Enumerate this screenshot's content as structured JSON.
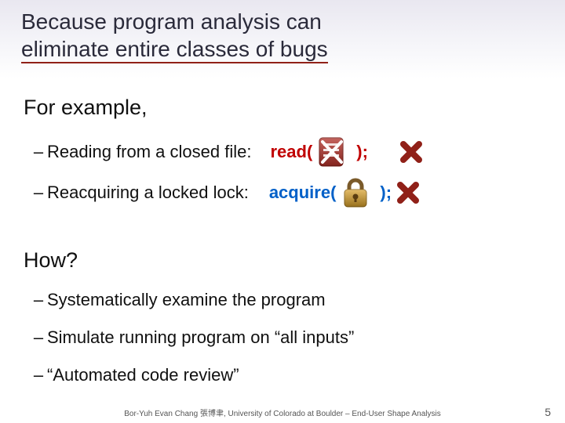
{
  "title": {
    "line1": "Because program analysis can",
    "line2": "eliminate entire classes of bugs"
  },
  "for_example_label": "For example,",
  "examples": [
    {
      "desc": "Reading from a closed file:",
      "call": "read(",
      "close": ");",
      "color": "red"
    },
    {
      "desc": "Reacquiring a locked lock:",
      "call": "acquire(",
      "close": ");",
      "color": "blue"
    }
  ],
  "how_label": "How?",
  "how_items": [
    "Systematically examine the program",
    "Simulate running program on “all inputs”",
    "“Automated code review”"
  ],
  "footer": "Bor-Yuh Evan Chang 張博聿, University of Colorado at Boulder – End-User Shape Analysis",
  "page": "5",
  "icons": {
    "file": "file-x-icon",
    "lock": "lock-icon",
    "cross": "x-cross-icon"
  }
}
